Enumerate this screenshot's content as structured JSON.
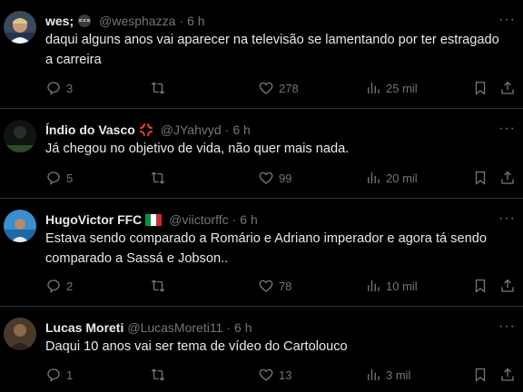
{
  "tweets": [
    {
      "name": "wes;",
      "handle": "@wesphazza",
      "time": "6 h",
      "text": "daqui alguns anos vai aparecer na televisão se lamentando por ter estragado a carreira",
      "replies": "3",
      "retweets": "",
      "likes": "278",
      "views": "25 mil"
    },
    {
      "name": "Índio do Vasco",
      "handle": "@JYahvyd",
      "time": "6 h",
      "text": "Já chegou no objetivo de vida, não quer mais nada.",
      "replies": "5",
      "retweets": "",
      "likes": "99",
      "views": "20 mil"
    },
    {
      "name": "HugoVictor FFC",
      "handle": "@viictorffc",
      "time": "6 h",
      "text": "Estava sendo comparado a Romário e Adriano imperador e agora tá sendo comparado a Sassá e Jobson..",
      "replies": "2",
      "retweets": "",
      "likes": "78",
      "views": "10 mil"
    },
    {
      "name": "Lucas Moreti",
      "handle": "@LucasMoreti11",
      "time": "6 h",
      "text": "Daqui 10 anos vai ser tema de vídeo do Cartolouco",
      "replies": "1",
      "retweets": "",
      "likes": "13",
      "views": "3 mil"
    }
  ],
  "colors": {
    "background": "#000000",
    "text": "#e7e9ea",
    "muted": "#71767b",
    "divider": "#2f3336"
  },
  "icons": [
    "reply-icon",
    "retweet-icon",
    "like-icon",
    "views-icon",
    "bookmark-icon",
    "share-icon",
    "more-icon"
  ]
}
